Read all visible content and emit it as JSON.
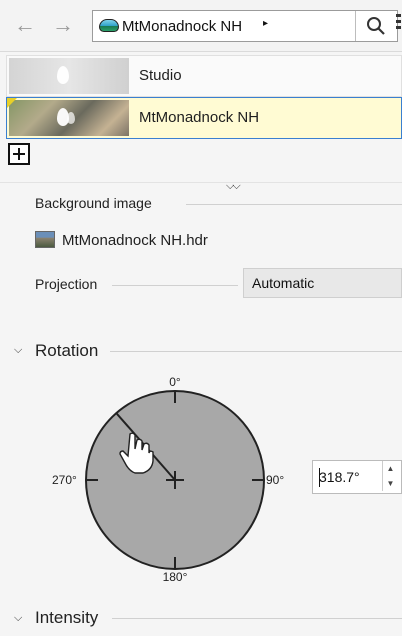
{
  "nav": {
    "back_icon": "arrow-left-icon",
    "forward_icon": "arrow-right-icon",
    "breadcrumb": "MtMonadnock NH",
    "breadcrumb_caret": "▸",
    "search_icon": "search-icon"
  },
  "environments": [
    {
      "label": "Studio",
      "selected": false
    },
    {
      "label": "MtMonadnock NH",
      "selected": true
    }
  ],
  "properties": {
    "background_image_label": "Background image",
    "background_image_file": "MtMonadnock NH.hdr",
    "projection_label": "Projection",
    "projection_value": "Automatic"
  },
  "rotation": {
    "section_title": "Rotation",
    "tick_0": "0°",
    "tick_90": "90°",
    "tick_180": "180°",
    "tick_270": "270°",
    "angle_value": "318.7°",
    "angle_degrees": 318.7
  },
  "intensity": {
    "section_title": "Intensity"
  },
  "colors": {
    "selection_bg": "#fffbd3",
    "selection_border": "#3a7fd0",
    "dial_fill": "#a8a8a8"
  }
}
